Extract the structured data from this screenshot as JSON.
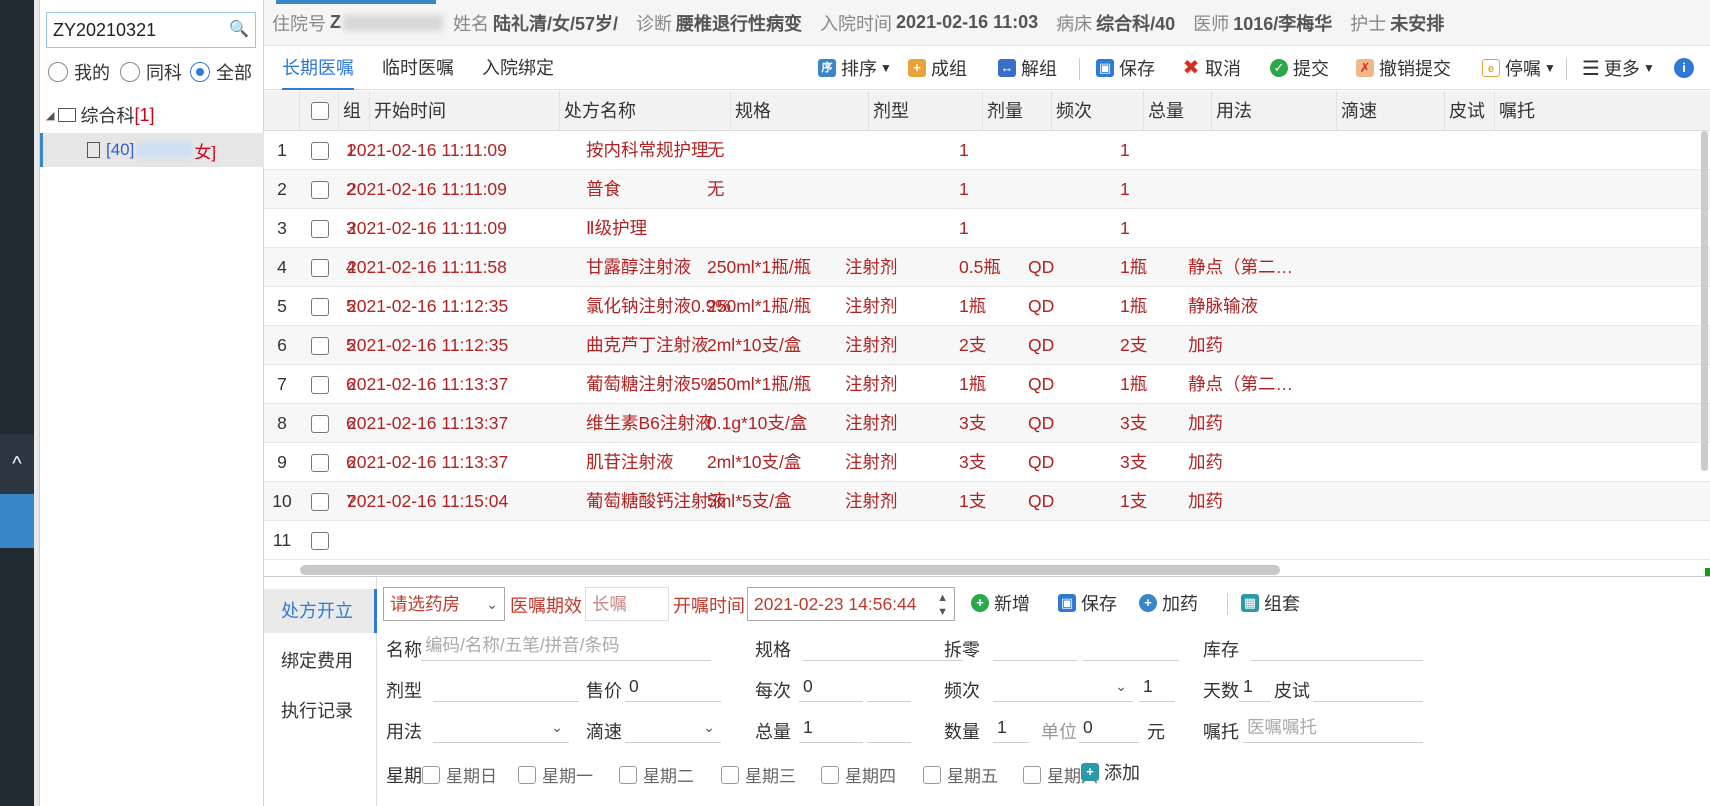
{
  "sidebar": {
    "collapse_glyph": "^"
  },
  "left": {
    "search_value": "ZY20210321",
    "radios": [
      {
        "label": "我的",
        "checked": false
      },
      {
        "label": "同科",
        "checked": false
      },
      {
        "label": "全部",
        "checked": true
      }
    ],
    "tree_dept": "综合科",
    "tree_dept_count": "[1]",
    "tree_patient_bed": "[40]",
    "tree_patient_gender": "女]"
  },
  "info": {
    "inpatient_label": "住院号",
    "inpatient_value": "Z",
    "name_label": "姓名",
    "name_value": "陆礼清/女/57岁/",
    "diag_label": "诊断",
    "diag_value": "腰椎退行性病变",
    "admit_label": "入院时间",
    "admit_value": "2021-02-16 11:03",
    "bed_label": "病床",
    "bed_value": "综合科/40",
    "doctor_label": "医师",
    "doctor_value": "1016/李梅华",
    "nurse_label": "护士",
    "nurse_value": "未安排"
  },
  "tabs": [
    "长期医嘱",
    "临时医嘱",
    "入院绑定"
  ],
  "toolbar": {
    "sort": "排序",
    "group": "成组",
    "ungroup": "解组",
    "save": "保存",
    "cancel": "取消",
    "submit": "提交",
    "undo_submit": "撤销提交",
    "stop": "停嘱",
    "more": "更多"
  },
  "grid": {
    "headers": [
      "组",
      "开始时间",
      "处方名称",
      "规格",
      "剂型",
      "剂量",
      "频次",
      "总量",
      "用法",
      "滴速",
      "皮试",
      "嘱托"
    ],
    "rows": [
      {
        "n": "1",
        "grp": "1",
        "time": "2021-02-16 11:11:09",
        "name": "按内科常规护理",
        "spec": "无",
        "form": "",
        "dose": "1",
        "freq": "",
        "total": "1",
        "usage": ""
      },
      {
        "n": "2",
        "grp": "2",
        "time": "2021-02-16 11:11:09",
        "name": "普食",
        "spec": "无",
        "form": "",
        "dose": "1",
        "freq": "",
        "total": "1",
        "usage": ""
      },
      {
        "n": "3",
        "grp": "3",
        "time": "2021-02-16 11:11:09",
        "name": "Ⅱ级护理",
        "spec": "",
        "form": "",
        "dose": "1",
        "freq": "",
        "total": "1",
        "usage": ""
      },
      {
        "n": "4",
        "grp": "4",
        "time": "2021-02-16 11:11:58",
        "name": "甘露醇注射液",
        "spec": "250ml*1瓶/瓶",
        "form": "注射剂",
        "dose": "0.5瓶",
        "freq": "QD",
        "total": "1瓶",
        "usage": "静点（第二…"
      },
      {
        "n": "5",
        "grp": "5",
        "time": "2021-02-16 11:12:35",
        "name": "氯化钠注射液0.9%",
        "spec": "250ml*1瓶/瓶",
        "form": "注射剂",
        "dose": "1瓶",
        "freq": "QD",
        "total": "1瓶",
        "usage": "静脉输液"
      },
      {
        "n": "6",
        "grp": "5",
        "time": "2021-02-16 11:12:35",
        "name": "曲克芦丁注射液",
        "spec": "2ml*10支/盒",
        "form": "注射剂",
        "dose": "2支",
        "freq": "QD",
        "total": "2支",
        "usage": "加药"
      },
      {
        "n": "7",
        "grp": "6",
        "time": "2021-02-16 11:13:37",
        "name": "葡萄糖注射液5%",
        "spec": "250ml*1瓶/瓶",
        "form": "注射剂",
        "dose": "1瓶",
        "freq": "QD",
        "total": "1瓶",
        "usage": "静点（第二…"
      },
      {
        "n": "8",
        "grp": "6",
        "time": "2021-02-16 11:13:37",
        "name": "维生素B6注射液",
        "spec": "0.1g*10支/盒",
        "form": "注射剂",
        "dose": "3支",
        "freq": "QD",
        "total": "3支",
        "usage": "加药"
      },
      {
        "n": "9",
        "grp": "6",
        "time": "2021-02-16 11:13:37",
        "name": "肌苷注射液",
        "spec": "2ml*10支/盒",
        "form": "注射剂",
        "dose": "3支",
        "freq": "QD",
        "total": "3支",
        "usage": "加药"
      },
      {
        "n": "10",
        "grp": "7",
        "time": "2021-02-16 11:15:04",
        "name": "葡萄糖酸钙注射液",
        "spec": "5ml*5支/盒",
        "form": "注射剂",
        "dose": "1支",
        "freq": "QD",
        "total": "1支",
        "usage": "加药"
      },
      {
        "n": "11",
        "grp": "",
        "time": "",
        "name": "",
        "spec": "",
        "form": "",
        "dose": "",
        "freq": "",
        "total": "",
        "usage": ""
      }
    ]
  },
  "bottom": {
    "side": [
      "处方开立",
      "绑定费用",
      "执行记录"
    ],
    "pharmacy": "请选药房",
    "validity_label": "医嘱期效",
    "validity_value": "长嘱",
    "open_time_label": "开嘱时间",
    "open_time_value": "2021-02-23 14:56:44",
    "actions": {
      "new": "新增",
      "save": "保存",
      "add_drug": "加药",
      "group": "组套"
    },
    "name_label": "名称",
    "name_placeholder": "编码/名称/五笔/拼音/条码",
    "spec_label": "规格",
    "split_label": "拆零",
    "stock_label": "库存",
    "form_label": "剂型",
    "price_label": "售价",
    "price_value": "0",
    "each_label": "每次",
    "each_value": "0",
    "freq_label": "频次",
    "freq_value": "1",
    "days_label": "天数",
    "days_value": "1",
    "skin_label": "皮试",
    "usage_label": "用法",
    "drip_label": "滴速",
    "total_label": "总量",
    "total_value": "1",
    "qty_label": "数量",
    "qty_value": "1",
    "unit_label": "单位",
    "unit_value": "0",
    "yuan": "元",
    "entrust_label": "嘱托",
    "entrust_placeholder": "医嘱嘱托",
    "week_label": "星期",
    "weekdays": [
      "星期日",
      "星期一",
      "星期二",
      "星期三",
      "星期四",
      "星期五",
      "星期六"
    ],
    "add_label": "添加"
  }
}
